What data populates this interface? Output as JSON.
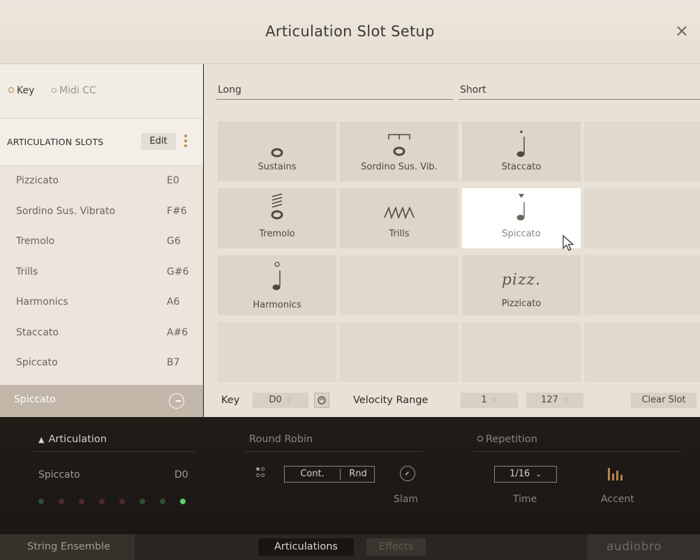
{
  "window": {
    "title": "Articulation Slot Setup",
    "close_glyph": "×"
  },
  "mode": {
    "key_label": "Key",
    "midi_label": "Midi CC",
    "selected": "Key"
  },
  "slots": {
    "header": "ARTICULATION SLOTS",
    "edit_label": "Edit",
    "items": [
      {
        "name": "Pizzicato",
        "key": "E0"
      },
      {
        "name": "Sordino Sus. Vibrato",
        "key": "F#6"
      },
      {
        "name": "Tremolo",
        "key": "G6"
      },
      {
        "name": "Trills",
        "key": "G#6"
      },
      {
        "name": "Harmonics",
        "key": "A6"
      },
      {
        "name": "Staccato",
        "key": "A#6"
      },
      {
        "name": "Spiccato",
        "key": "B7"
      }
    ],
    "selected": {
      "name": "Spiccato"
    }
  },
  "sections": {
    "long_label": "Long",
    "short_label": "Short"
  },
  "grid": {
    "cells": [
      {
        "label": "Sustains",
        "icon": "whole-note-icon"
      },
      {
        "label": "Sordino Sus. Vib.",
        "icon": "sordino-note-icon"
      },
      {
        "label": "Staccato",
        "icon": "staccato-note-icon"
      },
      {
        "label": "",
        "icon": ""
      },
      {
        "label": "Tremolo",
        "icon": "tremolo-note-icon"
      },
      {
        "label": "Trills",
        "icon": "trill-icon"
      },
      {
        "label": "Spiccato",
        "icon": "spiccato-note-icon"
      },
      {
        "label": "",
        "icon": ""
      },
      {
        "label": "Harmonics",
        "icon": "harmonic-note-icon"
      },
      {
        "label": "",
        "icon": ""
      },
      {
        "label": "Pizzicato",
        "icon": "pizz-text",
        "icon_text": "pizz."
      },
      {
        "label": "",
        "icon": ""
      },
      {
        "label": "",
        "icon": ""
      },
      {
        "label": "",
        "icon": ""
      },
      {
        "label": "",
        "icon": ""
      },
      {
        "label": "",
        "icon": ""
      }
    ],
    "active_label": "Spiccato"
  },
  "slot_settings": {
    "key_label": "Key",
    "key_value": "D0",
    "velocity_label": "Velocity Range",
    "velocity_min": "1",
    "velocity_max": "127",
    "clear_label": "Clear Slot",
    "stepper_glyph": "♢"
  },
  "articulation_panel": {
    "header": "Articulation",
    "name": "Spiccato",
    "key": "D0",
    "leds": [
      "dim-green",
      "dim-red",
      "dim-red",
      "dim-red",
      "dim-red",
      "dim-green",
      "dim-green",
      "lit-green"
    ]
  },
  "round_robin": {
    "header": "Round Robin",
    "cont_label": "Cont.",
    "rnd_label": "Rnd",
    "slam_label": "Slam"
  },
  "repetition": {
    "header": "Repetition",
    "time_value": "1/16",
    "time_label": "Time",
    "accent_label": "Accent"
  },
  "footer": {
    "instrument": "String Ensemble",
    "tab_articulations": "Articulations",
    "tab_effects": "Effects",
    "logo": "audiobro"
  },
  "colors": {
    "accent": "#c28a45",
    "led_on": "#5ad26a",
    "led_green_dim": "#2e5a33",
    "led_red_dim": "#5a2e2e",
    "active_cell": "#ffffff"
  }
}
